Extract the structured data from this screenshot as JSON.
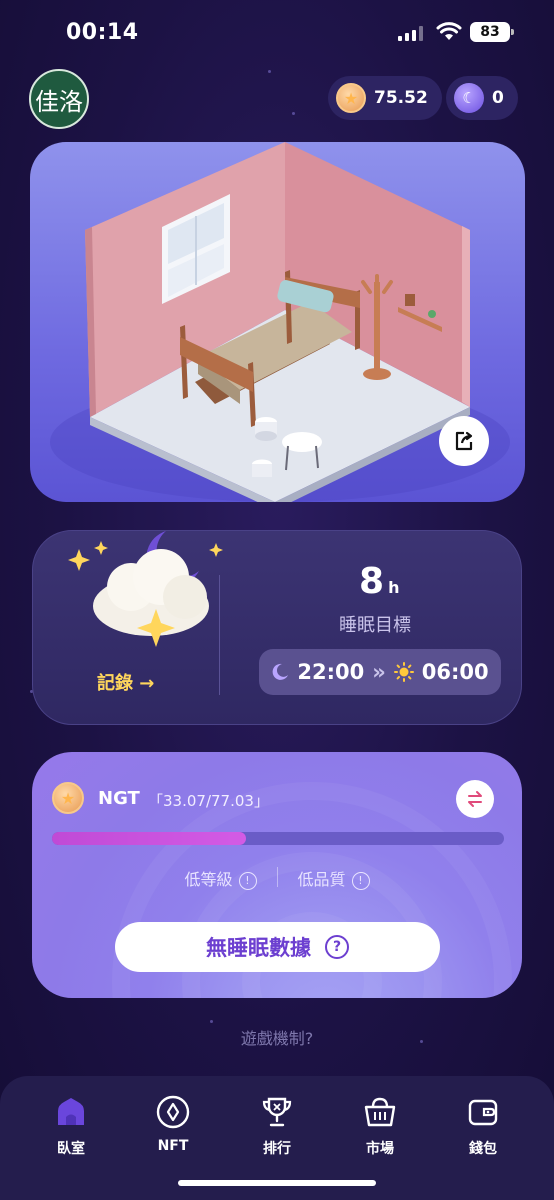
{
  "status_bar": {
    "time": "00:14",
    "battery": "83"
  },
  "header": {
    "avatar_text": "佳洛",
    "coin_balance": "75.52",
    "moon_balance": "0"
  },
  "sleep": {
    "record_label": "記錄 →",
    "goal_hours": "8",
    "goal_unit": "h",
    "goal_label": "睡眠目標",
    "bed_time": "22:00",
    "arrow": "»",
    "wake_time": "06:00"
  },
  "ngt": {
    "name": "NGT",
    "range": "「33.07/77.03」",
    "progress": 0.43,
    "level_low": "低等級",
    "quality_low": "低品質",
    "no_data_label": "無睡眠數據",
    "info_glyph": "!",
    "question_glyph": "?"
  },
  "footer": {
    "mechanism_link": "遊戲機制?"
  },
  "nav": {
    "items": [
      {
        "label": "臥室",
        "icon": "home-icon"
      },
      {
        "label": "NFT",
        "icon": "nft-icon"
      },
      {
        "label": "排行",
        "icon": "trophy-icon"
      },
      {
        "label": "市場",
        "icon": "basket-icon"
      },
      {
        "label": "錢包",
        "icon": "wallet-icon"
      }
    ]
  },
  "colors": {
    "background": "#1c1244",
    "accent_yellow": "#ffd65c",
    "accent_purple": "#6c3fd0",
    "progress_fill": "#c04ad6"
  }
}
